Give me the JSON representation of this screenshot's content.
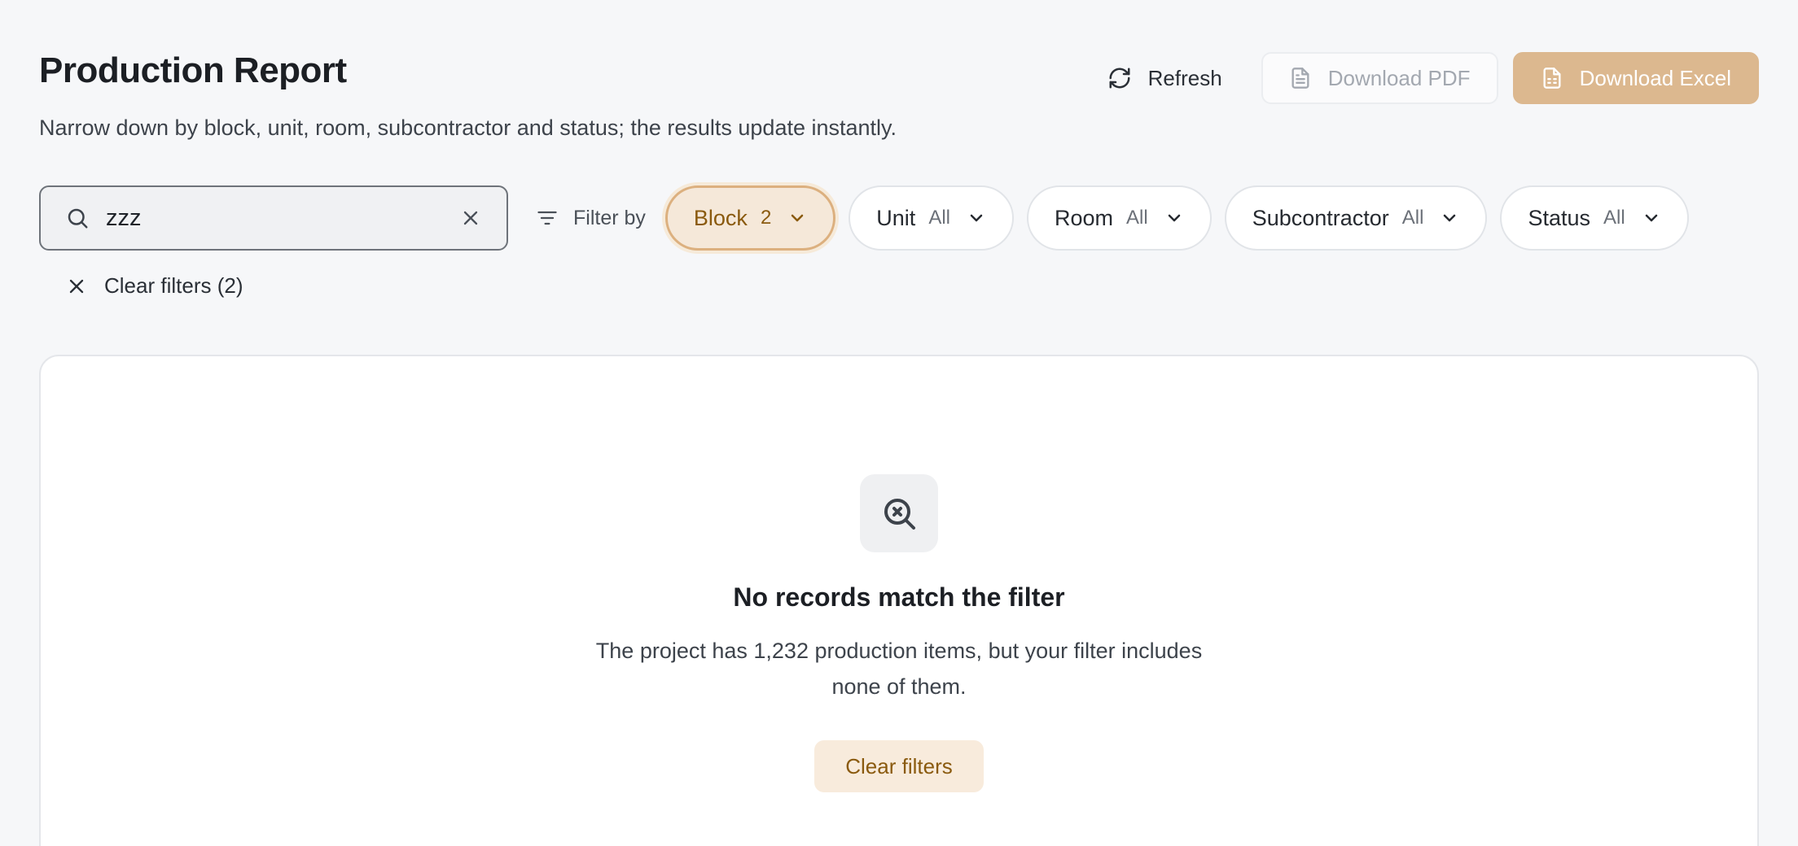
{
  "header": {
    "title": "Production Report",
    "subtitle": "Narrow down by block, unit, room, subcontractor and status; the results update instantly."
  },
  "actions": {
    "refresh_label": "Refresh",
    "download_pdf_label": "Download PDF",
    "download_excel_label": "Download Excel"
  },
  "search": {
    "value": "zzz"
  },
  "filter_by_label": "Filter by",
  "filters": [
    {
      "label": "Block",
      "value": "2",
      "active": true
    },
    {
      "label": "Unit",
      "value": "All",
      "active": false
    },
    {
      "label": "Room",
      "value": "All",
      "active": false
    },
    {
      "label": "Subcontractor",
      "value": "All",
      "active": false
    },
    {
      "label": "Status",
      "value": "All",
      "active": false
    }
  ],
  "clear_filters_label": "Clear filters (2)",
  "empty_state": {
    "title": "No records match the filter",
    "description": "The project has 1,232 production items, but your filter includes none of them.",
    "button_label": "Clear filters"
  },
  "colors": {
    "accent": "#dcb88f",
    "accent_text": "#8a5a0e",
    "accent_bg": "#f5e8d9"
  }
}
